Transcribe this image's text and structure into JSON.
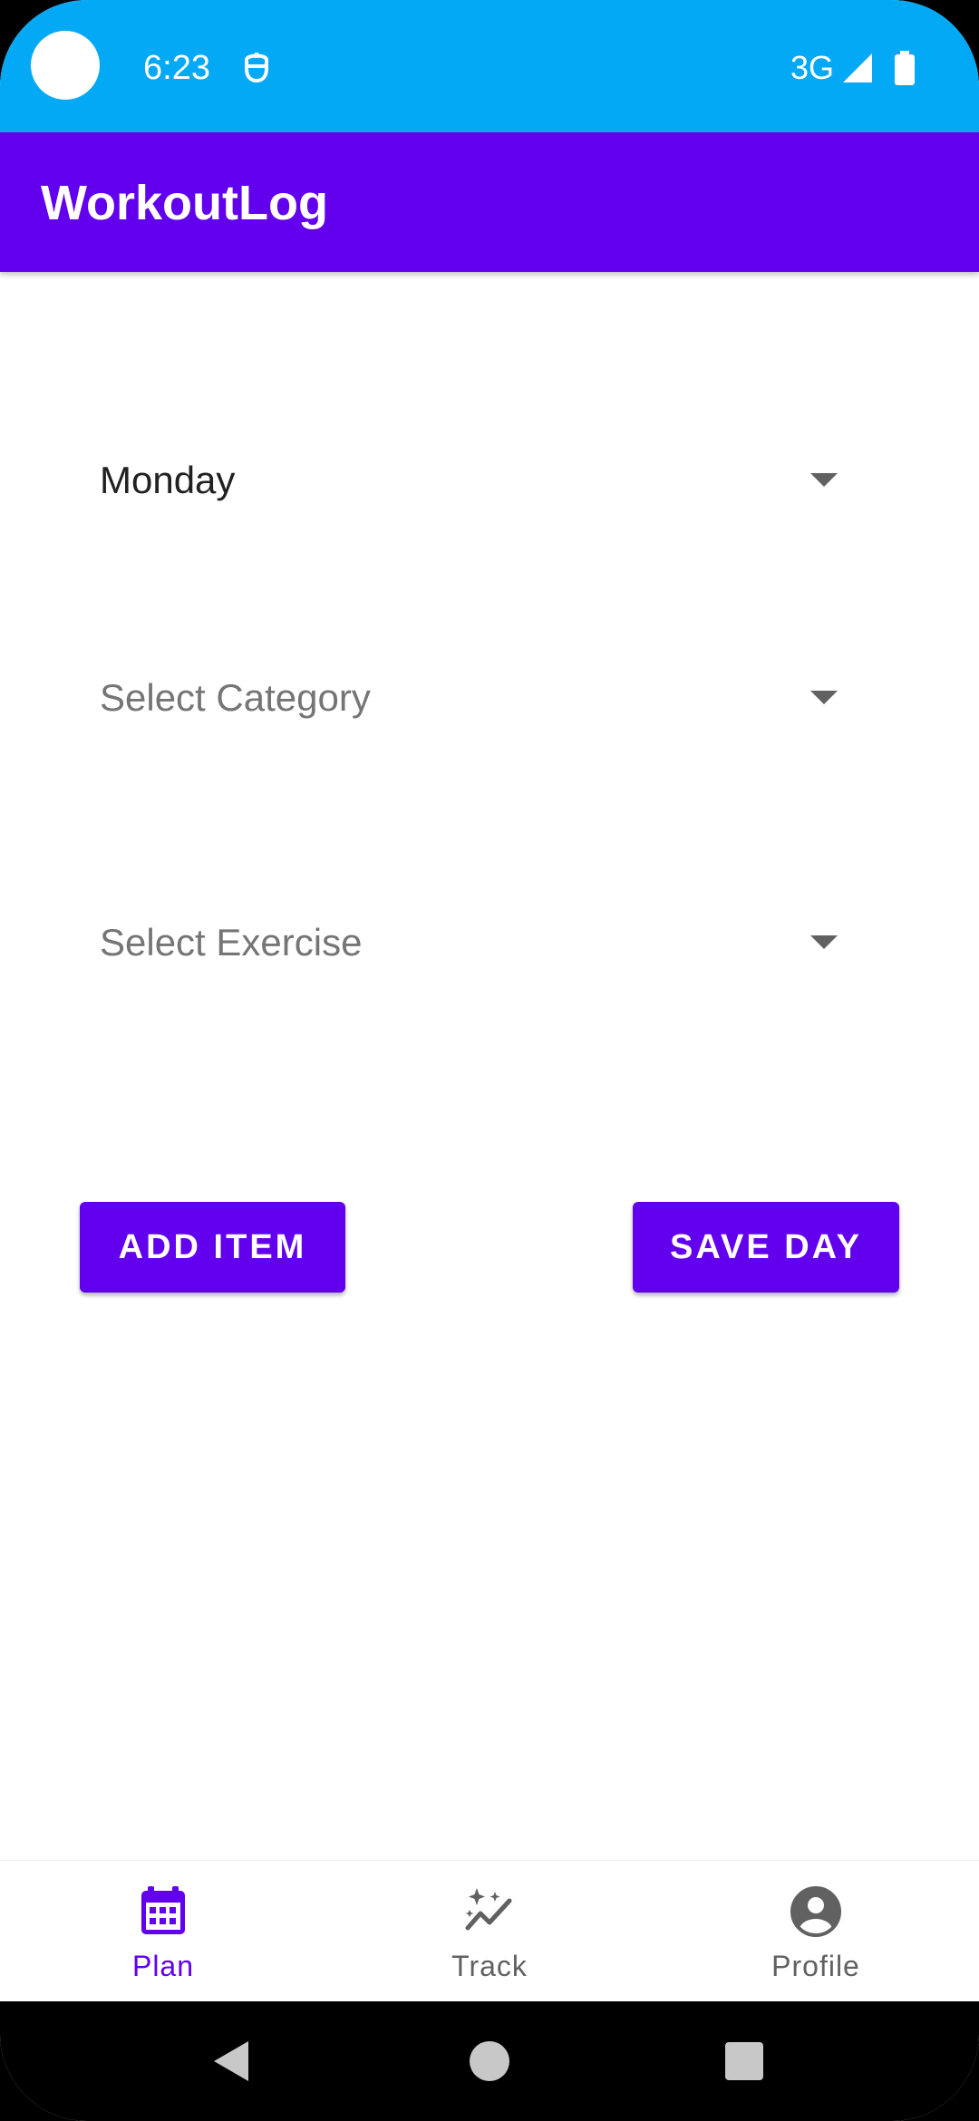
{
  "status_bar": {
    "time": "6:23",
    "network": "3G",
    "background_color": "#03A9F4",
    "icons": [
      "notification-icon",
      "signal-icon",
      "battery-icon"
    ]
  },
  "app_bar": {
    "title": "WorkoutLog",
    "background_color": "#6200EE"
  },
  "form": {
    "day_spinner": {
      "value": "Monday"
    },
    "category_spinner": {
      "placeholder": "Select Category"
    },
    "exercise_spinner": {
      "placeholder": "Select Exercise"
    }
  },
  "buttons": {
    "add_item": "ADD ITEM",
    "save_day": "SAVE DAY",
    "color": "#6200EE"
  },
  "bottom_nav": {
    "active": "Plan",
    "items": [
      {
        "label": "Plan",
        "icon": "calendar-icon"
      },
      {
        "label": "Track",
        "icon": "auto-graph-icon"
      },
      {
        "label": "Profile",
        "icon": "account-circle-icon"
      }
    ]
  },
  "system_nav": {
    "buttons": [
      "back-icon",
      "home-icon",
      "recents-icon"
    ]
  }
}
